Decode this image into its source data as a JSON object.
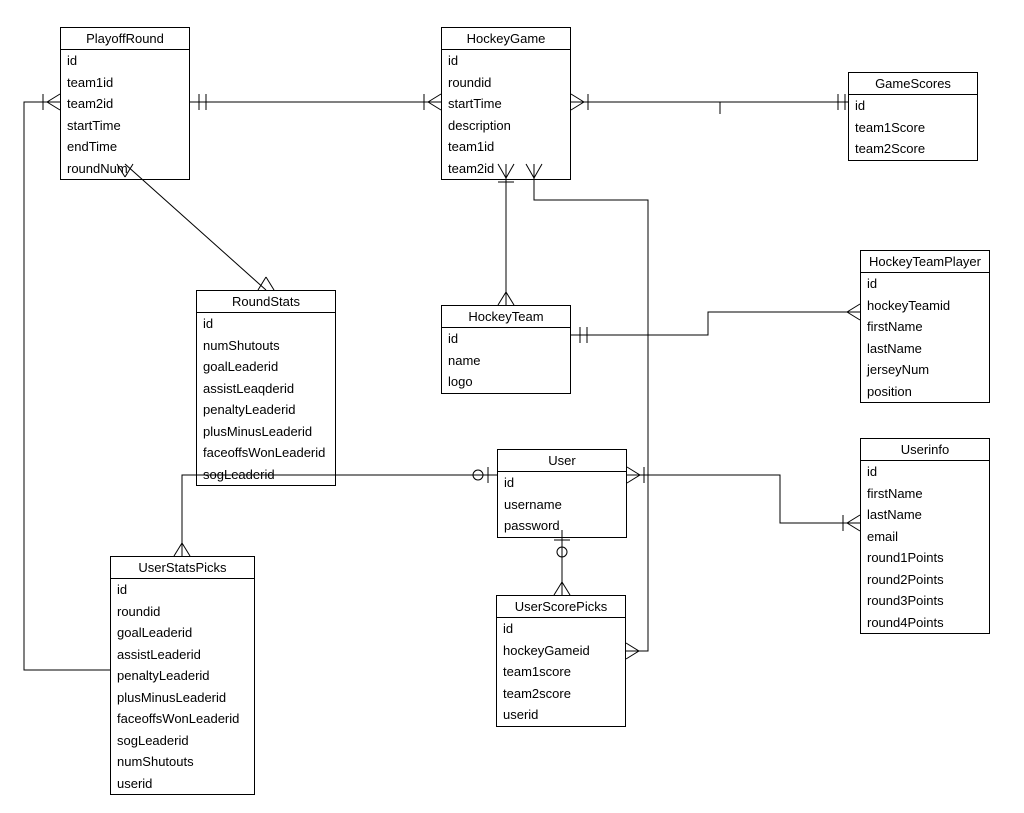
{
  "entities": {
    "playoffRound": {
      "title": "PlayoffRound",
      "attrs": [
        "id",
        "team1id",
        "team2id",
        "startTime",
        "endTime",
        "roundNum"
      ]
    },
    "hockeyGame": {
      "title": "HockeyGame",
      "attrs": [
        "id",
        "roundid",
        "startTime",
        "description",
        "team1id",
        "team2id"
      ]
    },
    "gameScores": {
      "title": "GameScores",
      "attrs": [
        "id",
        "team1Score",
        "team2Score"
      ]
    },
    "hockeyTeamPlayer": {
      "title": "HockeyTeamPlayer",
      "attrs": [
        "id",
        "hockeyTeamid",
        "firstName",
        "lastName",
        "jerseyNum",
        "position"
      ]
    },
    "roundStats": {
      "title": "RoundStats",
      "attrs": [
        "id",
        "numShutouts",
        "goalLeaderid",
        "assistLeaqderid",
        "penaltyLeaderid",
        "plusMinusLeaderid",
        "faceoffsWonLeaderid",
        "sogLeaderid"
      ]
    },
    "hockeyTeam": {
      "title": "HockeyTeam",
      "attrs": [
        "id",
        "name",
        "logo"
      ]
    },
    "user": {
      "title": "User",
      "attrs": [
        "id",
        "username",
        "password"
      ]
    },
    "userinfo": {
      "title": "Userinfo",
      "attrs": [
        "id",
        "firstName",
        "lastName",
        "email",
        "round1Points",
        "round2Points",
        "round3Points",
        "round4Points"
      ]
    },
    "userStatsPicks": {
      "title": "UserStatsPicks",
      "attrs": [
        "id",
        "roundid",
        "goalLeaderid",
        "assistLeaderid",
        "penaltyLeaderid",
        "plusMinusLeaderid",
        "faceoffsWonLeaderid",
        "sogLeaderid",
        "numShutouts",
        "userid"
      ]
    },
    "userScorePicks": {
      "title": "UserScorePicks",
      "attrs": [
        "id",
        "hockeyGameid",
        "team1score",
        "team2score",
        "userid"
      ]
    }
  }
}
